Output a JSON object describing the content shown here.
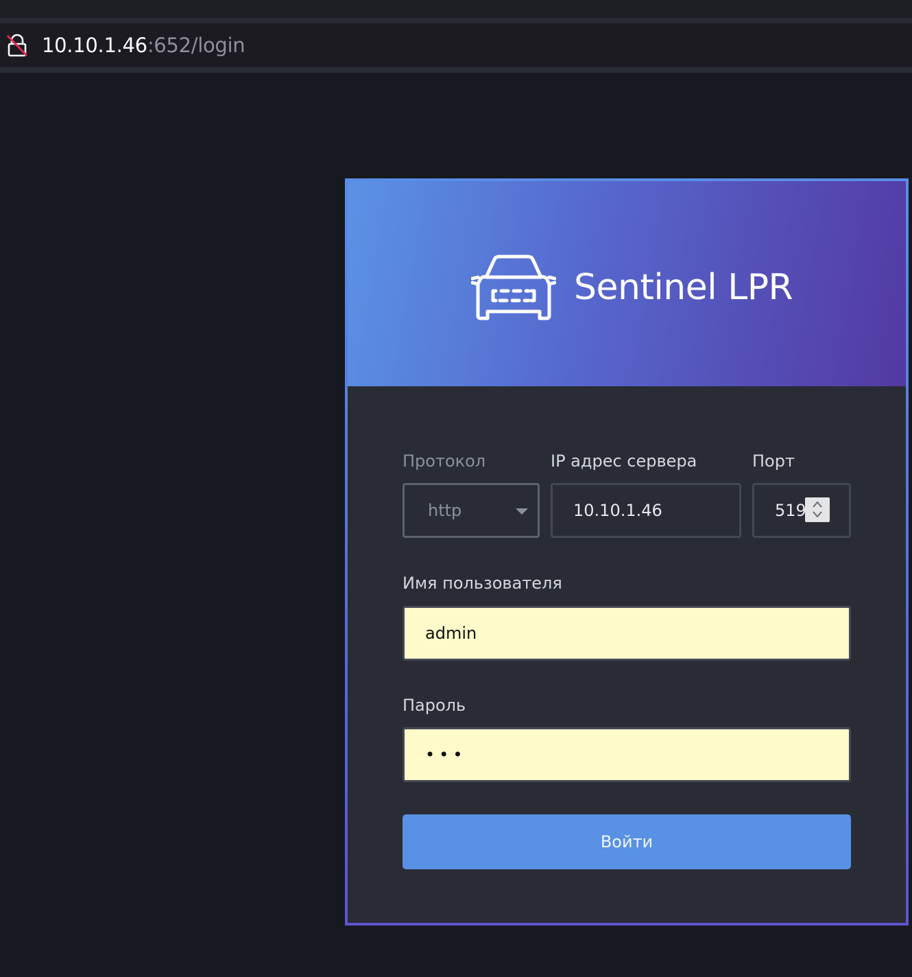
{
  "browser": {
    "url_host": "10.10.1.46",
    "url_rest": ":652/login",
    "lock_icon": "insecure-lock-icon"
  },
  "app": {
    "brand": "Sentinel LPR",
    "logo_icon": "car-icon",
    "colors": {
      "header_gradient_start": "#5a92e6",
      "header_gradient_end": "#5339a2",
      "card_bg": "#292c35",
      "button_bg": "#5891e5",
      "autofill_bg": "#fefac9"
    }
  },
  "form": {
    "protocol_label": "Протокол",
    "protocol_value": "http",
    "ip_label": "IP адрес сервера",
    "ip_value": "10.10.1.46",
    "port_label": "Порт",
    "port_value": "519",
    "username_label": "Имя пользователя",
    "username_value": "admin",
    "password_label": "Пароль",
    "password_masked": "•••",
    "submit_label": "Войти"
  }
}
